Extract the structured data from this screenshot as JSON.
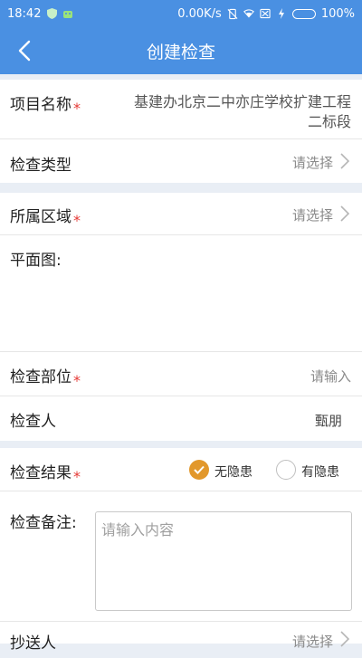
{
  "statusbar": {
    "time": "18:42",
    "speed": "0.00K/s",
    "battery": "100%"
  },
  "appbar": {
    "title": "创建检查",
    "back_icon": "chevron-left-icon"
  },
  "form": {
    "project_name": {
      "label": "项目名称",
      "value_line1": "基建办北京二中亦庄学校扩建工程",
      "value_line2": "二标段"
    },
    "inspection_type": {
      "label": "检查类型",
      "placeholder": "请选择"
    },
    "area": {
      "label": "所属区域",
      "placeholder": "请选择"
    },
    "plan": {
      "label": "平面图:"
    },
    "part": {
      "label": "检查部位",
      "placeholder": "请输入"
    },
    "inspector": {
      "label": "检查人",
      "value": "甄朋"
    },
    "result": {
      "label": "检查结果",
      "option_no_hazard": "无隐患",
      "option_hazard": "有隐患",
      "selected": "无隐患"
    },
    "remark": {
      "label": "检查备注:",
      "placeholder": "请输入内容"
    },
    "cc": {
      "label": "抄送人",
      "placeholder": "请选择"
    }
  },
  "colors": {
    "primary": "#4a90e2",
    "required": "#e53935",
    "radio_selected": "#e2982c"
  }
}
